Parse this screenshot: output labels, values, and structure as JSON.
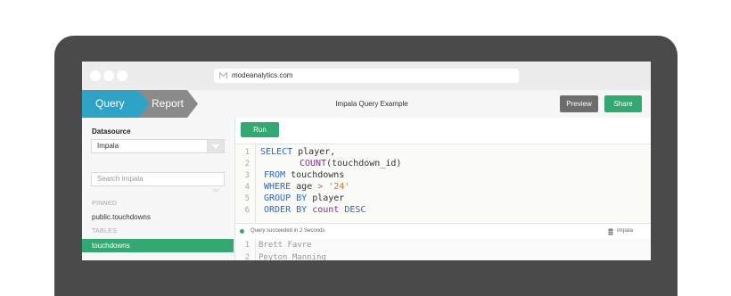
{
  "browser": {
    "url": "modeanalytics.com"
  },
  "header": {
    "tabs": [
      {
        "label": "Query",
        "active": true
      },
      {
        "label": "Report",
        "active": false
      }
    ],
    "title": "Impala Query Example",
    "preview_label": "Preview",
    "share_label": "Share"
  },
  "sidebar": {
    "datasource_label": "Datasource",
    "datasource_value": "Impala",
    "search_placeholder": "Search Impala",
    "pinned_label": "PINNED",
    "pinned_items": [
      "public.touchdowns"
    ],
    "tables_label": "TABLES",
    "tables_items": [
      "touchdowns"
    ]
  },
  "editor": {
    "run_label": "Run",
    "line_numbers": [
      "1",
      "2",
      "3",
      "4",
      "5",
      "6"
    ],
    "lines": [
      "SELECT player,",
      "COUNT(touchdown_id)",
      "FROM touchdowns",
      "WHERE age > '24'",
      "GROUP BY player",
      "ORDER BY count DESC"
    ]
  },
  "status": {
    "message": "Query succeeded in 2 Seconds",
    "datasource": "Impala"
  },
  "results": {
    "row_numbers": [
      "1",
      "2"
    ],
    "rows": [
      "Brett Favre",
      "Peyton Manning"
    ]
  },
  "colors": {
    "query_tab": "#2fa3c6",
    "report_tab": "#8a8a8a",
    "accent_green": "#33a873",
    "keyword": "#2a67c4",
    "function": "#8b2c9c",
    "string": "#e06c2c"
  }
}
